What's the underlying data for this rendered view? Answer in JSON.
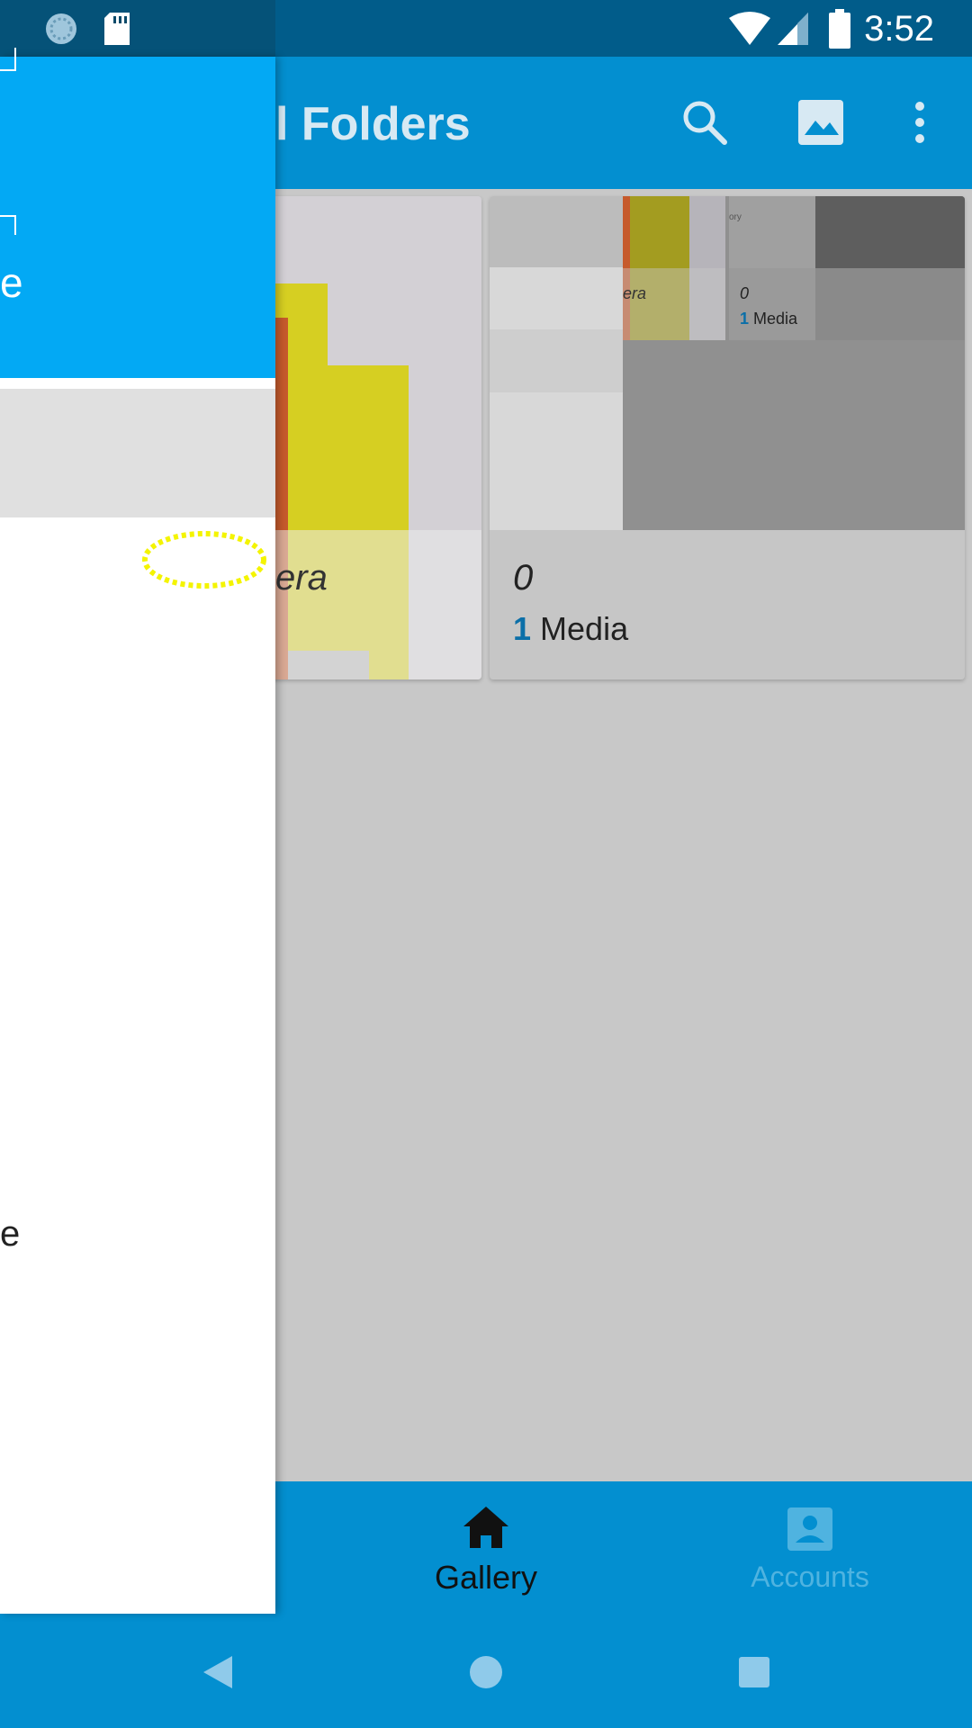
{
  "status_bar": {
    "time": "3:52",
    "icons": [
      "sync-icon",
      "sd-card-icon",
      "wifi-icon",
      "signal-icon",
      "battery-icon"
    ]
  },
  "app_bar": {
    "title": "l Folders",
    "icons": [
      "search-icon",
      "image-icon",
      "more-vert-icon"
    ]
  },
  "albums": [
    {
      "name": "era",
      "count": "",
      "media_label": ""
    },
    {
      "name": "0",
      "count": "1",
      "media_label": "Media"
    }
  ],
  "nested_preview": {
    "left_name": "era",
    "right_name": "0",
    "right_count": "1",
    "right_media_label": "Media",
    "tiny_label": "ory"
  },
  "drawer": {
    "header_text": "e",
    "item_text": "e"
  },
  "bottom_nav": {
    "items": [
      {
        "label": "Gallery",
        "icon": "home-icon",
        "active": true
      },
      {
        "label": "Accounts",
        "icon": "account-box-icon",
        "active": false
      }
    ]
  },
  "system_nav": [
    "back-icon",
    "home-circle-icon",
    "recents-icon"
  ],
  "colors": {
    "primary": "#038fd0",
    "primary_dark": "#015c8a",
    "drawer_header": "#03a9f4",
    "accent_count": "#0b6fa8"
  }
}
